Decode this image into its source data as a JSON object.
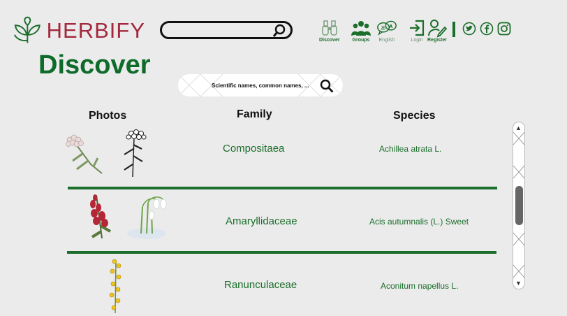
{
  "brand": {
    "name": "HERBIFY"
  },
  "header_search": {
    "placeholder": ""
  },
  "nav": [
    {
      "label": "Discover",
      "icon": "binoculars-icon"
    },
    {
      "label": "Groups",
      "icon": "group-icon"
    },
    {
      "label": "English",
      "icon": "language-icon"
    },
    {
      "label": "Login",
      "icon": "login-icon"
    },
    {
      "label": "Register",
      "icon": "register-icon"
    }
  ],
  "social": [
    "twitter-icon",
    "facebook-icon",
    "instagram-icon"
  ],
  "page": {
    "title": "Discover",
    "search_placeholder": "Scientific names, common names, ..."
  },
  "table": {
    "headers": {
      "photos": "Photos",
      "family": "Family",
      "species": "Species"
    },
    "rows": [
      {
        "family": "Compositaea",
        "species": "Achillea atrata L.",
        "photos": [
          "yarrow-colored",
          "yarrow-sketch"
        ]
      },
      {
        "family": "Amaryllidaceae",
        "species": "Acis autumnalis (L.) Sweet",
        "photos": [
          "foxglove",
          "snowdrop"
        ]
      },
      {
        "family": "Ranunculaceae",
        "species": "Aconitum napellus L.",
        "photos": [
          "yellow-flower"
        ]
      }
    ]
  },
  "colors": {
    "brand_green": "#1b6e2b",
    "title_green": "#0f6b2a",
    "logo_red": "#a3283d",
    "background": "#ebebeb"
  }
}
